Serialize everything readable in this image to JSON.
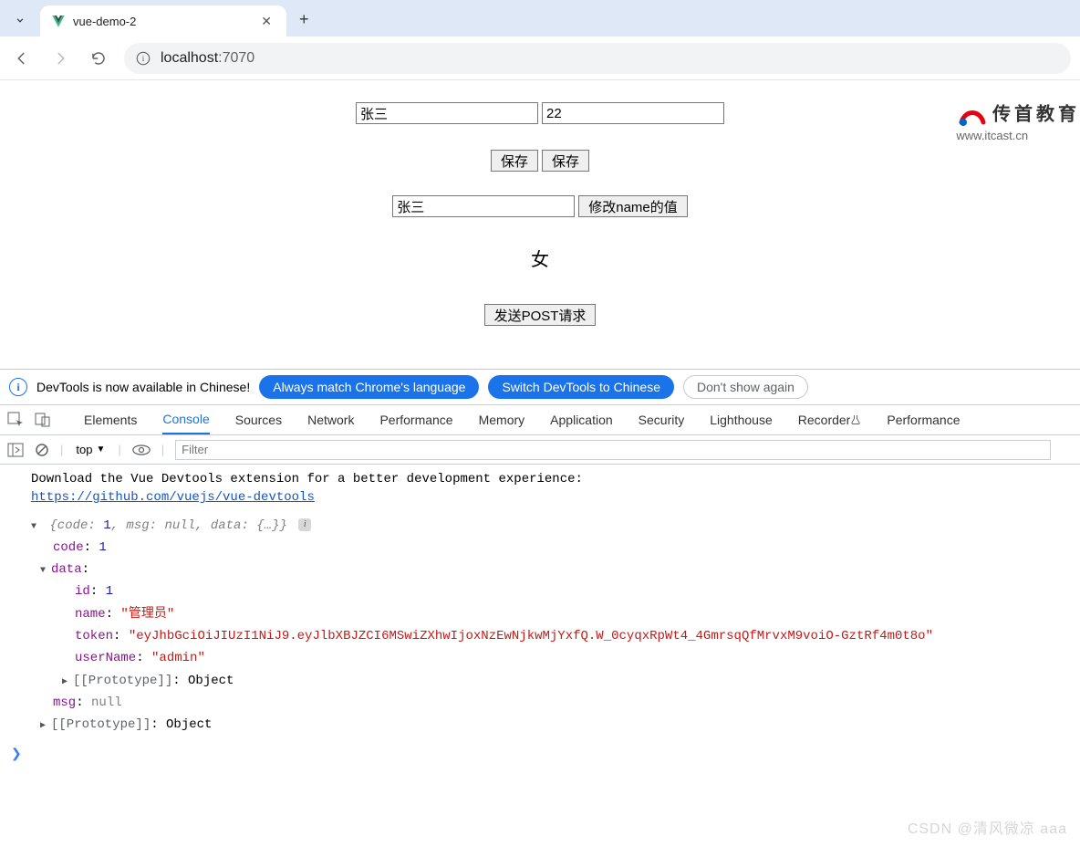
{
  "browser": {
    "tab_title": "vue-demo-2",
    "url_host": "localhost",
    "url_port": ":7070"
  },
  "page": {
    "input_name": "张三",
    "input_age": "22",
    "btn_save1": "保存",
    "btn_save2": "保存",
    "input_name2": "张三",
    "btn_modify": "修改name的值",
    "gender": "女",
    "btn_post": "发送POST请求",
    "logo_cn": "传首教育",
    "logo_url": "www.itcast.cn"
  },
  "banner": {
    "text": "DevTools is now available in Chinese!",
    "btn_always": "Always match Chrome's language",
    "btn_switch": "Switch DevTools to Chinese",
    "btn_hide": "Don't show again"
  },
  "devtools_tabs": [
    "Elements",
    "Console",
    "Sources",
    "Network",
    "Performance",
    "Memory",
    "Application",
    "Security",
    "Lighthouse",
    "Recorder",
    "Performance"
  ],
  "devtools_active_tab": "Console",
  "console_toolbar": {
    "context": "top",
    "filter_placeholder": "Filter"
  },
  "console": {
    "msg_line": "Download the Vue Devtools extension for a better development experience:",
    "msg_link": "https://github.com/vuejs/vue-devtools",
    "summary_prefix": "{code: ",
    "summary_code": "1",
    "summary_mid1": ", msg: ",
    "summary_msg": "null",
    "summary_mid2": ", data: ",
    "summary_data": "{…}",
    "summary_suffix": "}",
    "code_k": "code",
    "code_v": "1",
    "data_k": "data",
    "id_k": "id",
    "id_v": "1",
    "name_k": "name",
    "name_v": "\"管理员\"",
    "token_k": "token",
    "token_v": "\"eyJhbGciOiJIUzI1NiJ9.eyJlbXBJZCI6MSwiZXhwIjoxNzEwNjkwMjYxfQ.W_0cyqxRpWt4_4GmrsqQfMrvxM9voiO-GztRf4m0t8o\"",
    "username_k": "userName",
    "username_v": "\"admin\"",
    "proto_label": "[[Prototype]]",
    "proto_val": "Object",
    "msg_k": "msg",
    "msg_v": "null"
  },
  "watermark": "CSDN @清风微凉 aaa"
}
